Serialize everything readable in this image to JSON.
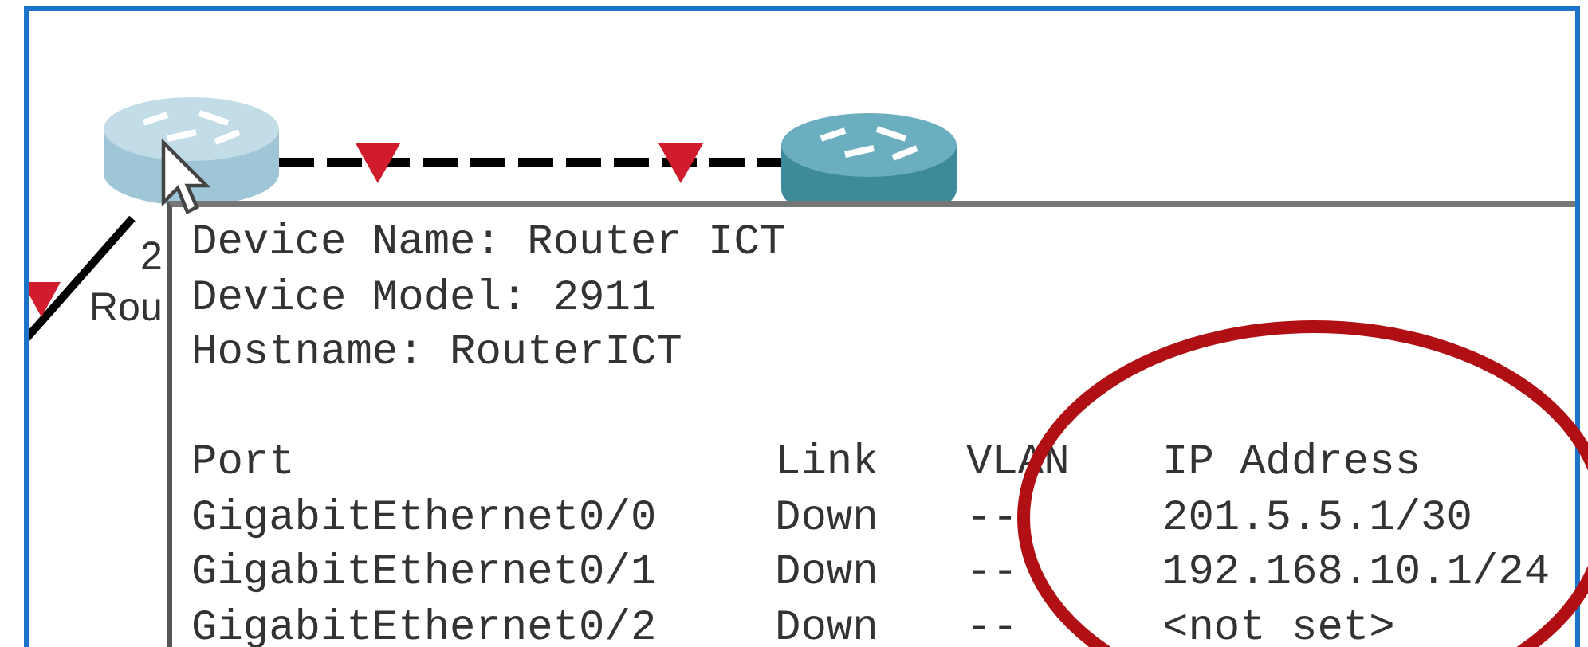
{
  "canvas": {
    "labels": [
      {
        "text": "2"
      },
      {
        "text": "Rou"
      }
    ]
  },
  "tooltip": {
    "info": [
      {
        "label": "Device Name:",
        "value": "Router ICT"
      },
      {
        "label": "Device Model:",
        "value": "2911"
      },
      {
        "label": "Hostname:",
        "value": "RouterICT"
      }
    ],
    "ports": {
      "columns": [
        "Port",
        "Link",
        "VLAN",
        "IP Address"
      ],
      "rows": [
        [
          "GigabitEthernet0/0",
          "Down",
          "--",
          "201.5.5.1/30"
        ],
        [
          "GigabitEthernet0/1",
          "Down",
          "--",
          "192.168.10.1/24"
        ],
        [
          "GigabitEthernet0/2",
          "Down",
          "--",
          "<not set>"
        ]
      ]
    }
  }
}
